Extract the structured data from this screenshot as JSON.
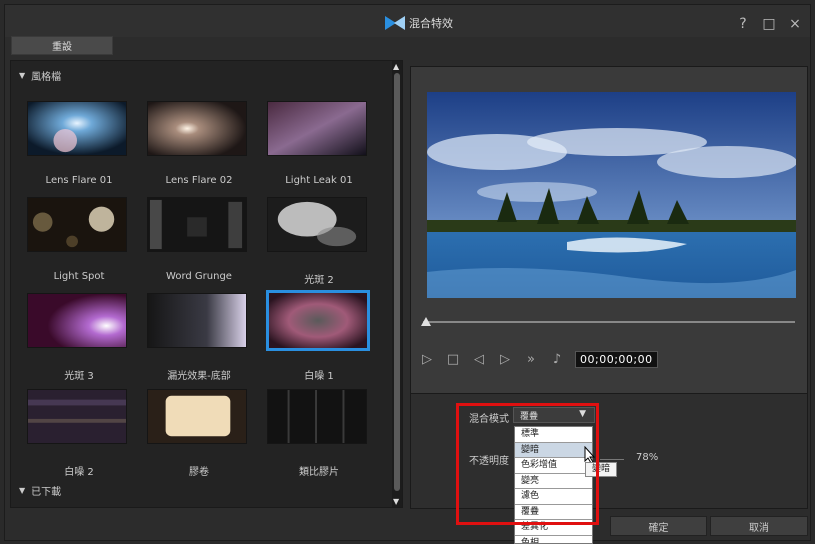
{
  "window": {
    "title": "混合特效"
  },
  "controls": {
    "help": "?",
    "maximize": "□",
    "close": "×"
  },
  "toolbar": {
    "reset_label": "重設"
  },
  "library": {
    "category_style": "風格檔",
    "category_downloaded": "已下載",
    "items": [
      {
        "label": "Lens Flare 01"
      },
      {
        "label": "Lens Flare 02"
      },
      {
        "label": "Light Leak 01"
      },
      {
        "label": "Light Spot"
      },
      {
        "label": "Word Grunge"
      },
      {
        "label": "光斑 2"
      },
      {
        "label": "光斑 3"
      },
      {
        "label": "漏光效果-底部"
      },
      {
        "label": "白噪 1"
      },
      {
        "label": "白噪 2"
      },
      {
        "label": "膠卷"
      },
      {
        "label": "類比膠片"
      }
    ]
  },
  "player": {
    "timecode": "00;00;00;00"
  },
  "settings": {
    "blend_mode_label": "混合模式",
    "blend_mode_value": "覆疊",
    "opacity_label": "不透明度",
    "opacity_value": "78%",
    "blend_options": [
      "標準",
      "變暗",
      "色彩增值",
      "變亮",
      "濾色",
      "覆疊",
      "差異化",
      "色相"
    ],
    "tooltip": "變暗"
  },
  "footer": {
    "ok_label": "確定",
    "cancel_label": "取消"
  },
  "colors": {
    "selection": "#2a8fe0",
    "annotation": "#e01010"
  }
}
